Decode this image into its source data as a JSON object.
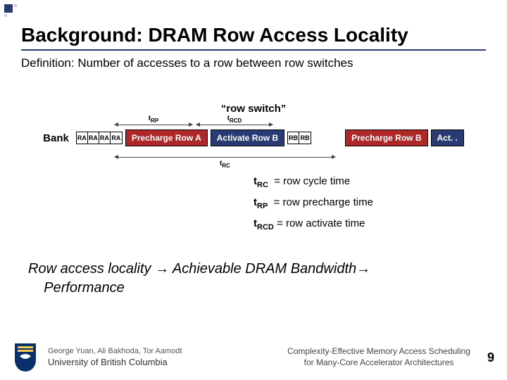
{
  "title": "Background: DRAM Row Access Locality",
  "subtitle": "Definition: Number of accesses to a row between row switches",
  "row_switch_label": "“row switch”",
  "bank_label": "Bank",
  "diagram": {
    "ra_cells": [
      "RA",
      "RA",
      "RA",
      "RA"
    ],
    "precharge_a": "Precharge Row A",
    "activate_b": "Activate Row B",
    "rb_cells": [
      "RB",
      "RB"
    ],
    "precharge_b": "Precharge Row B",
    "act_tail": "Act. .",
    "t_rp": "t",
    "t_rp_sub": "RP",
    "t_rcd": "t",
    "t_rcd_sub": "RCD",
    "t_rc": "t",
    "t_rc_sub": "RC"
  },
  "legend": {
    "rc": {
      "sym": "t",
      "sub": "RC",
      "desc": "= row cycle time"
    },
    "rp": {
      "sym": "t",
      "sub": "RP",
      "desc": "= row precharge time"
    },
    "rcd": {
      "sym": "t",
      "sub": "RCD",
      "desc": "= row activate time"
    }
  },
  "conclusion_prefix": "Row access locality ",
  "conclusion_mid": " Achievable DRAM Bandwidth",
  "conclusion_tail": " Performance",
  "arrow_glyph": "→",
  "footer": {
    "authors": "George Yuan, Ali Bakhoda, Tor Aamodt",
    "affiliation": "University of British Columbia",
    "paper_line1": "Complexity-Effective Memory Access Scheduling",
    "paper_line2": "for Many-Core Accelerator Architectures",
    "page": "9"
  }
}
